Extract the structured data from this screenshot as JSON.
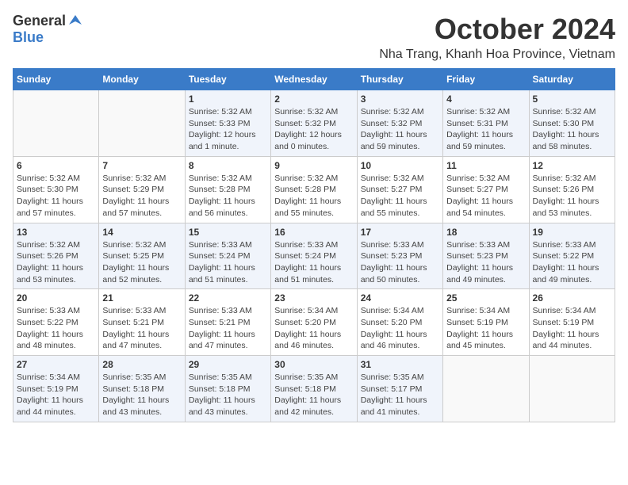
{
  "header": {
    "logo_general": "General",
    "logo_blue": "Blue",
    "month": "October 2024",
    "location": "Nha Trang, Khanh Hoa Province, Vietnam"
  },
  "days_of_week": [
    "Sunday",
    "Monday",
    "Tuesday",
    "Wednesday",
    "Thursday",
    "Friday",
    "Saturday"
  ],
  "weeks": [
    [
      {
        "day": "",
        "detail": ""
      },
      {
        "day": "",
        "detail": ""
      },
      {
        "day": "1",
        "detail": "Sunrise: 5:32 AM\nSunset: 5:33 PM\nDaylight: 12 hours\nand 1 minute."
      },
      {
        "day": "2",
        "detail": "Sunrise: 5:32 AM\nSunset: 5:32 PM\nDaylight: 12 hours\nand 0 minutes."
      },
      {
        "day": "3",
        "detail": "Sunrise: 5:32 AM\nSunset: 5:32 PM\nDaylight: 11 hours\nand 59 minutes."
      },
      {
        "day": "4",
        "detail": "Sunrise: 5:32 AM\nSunset: 5:31 PM\nDaylight: 11 hours\nand 59 minutes."
      },
      {
        "day": "5",
        "detail": "Sunrise: 5:32 AM\nSunset: 5:30 PM\nDaylight: 11 hours\nand 58 minutes."
      }
    ],
    [
      {
        "day": "6",
        "detail": "Sunrise: 5:32 AM\nSunset: 5:30 PM\nDaylight: 11 hours\nand 57 minutes."
      },
      {
        "day": "7",
        "detail": "Sunrise: 5:32 AM\nSunset: 5:29 PM\nDaylight: 11 hours\nand 57 minutes."
      },
      {
        "day": "8",
        "detail": "Sunrise: 5:32 AM\nSunset: 5:28 PM\nDaylight: 11 hours\nand 56 minutes."
      },
      {
        "day": "9",
        "detail": "Sunrise: 5:32 AM\nSunset: 5:28 PM\nDaylight: 11 hours\nand 55 minutes."
      },
      {
        "day": "10",
        "detail": "Sunrise: 5:32 AM\nSunset: 5:27 PM\nDaylight: 11 hours\nand 55 minutes."
      },
      {
        "day": "11",
        "detail": "Sunrise: 5:32 AM\nSunset: 5:27 PM\nDaylight: 11 hours\nand 54 minutes."
      },
      {
        "day": "12",
        "detail": "Sunrise: 5:32 AM\nSunset: 5:26 PM\nDaylight: 11 hours\nand 53 minutes."
      }
    ],
    [
      {
        "day": "13",
        "detail": "Sunrise: 5:32 AM\nSunset: 5:26 PM\nDaylight: 11 hours\nand 53 minutes."
      },
      {
        "day": "14",
        "detail": "Sunrise: 5:32 AM\nSunset: 5:25 PM\nDaylight: 11 hours\nand 52 minutes."
      },
      {
        "day": "15",
        "detail": "Sunrise: 5:33 AM\nSunset: 5:24 PM\nDaylight: 11 hours\nand 51 minutes."
      },
      {
        "day": "16",
        "detail": "Sunrise: 5:33 AM\nSunset: 5:24 PM\nDaylight: 11 hours\nand 51 minutes."
      },
      {
        "day": "17",
        "detail": "Sunrise: 5:33 AM\nSunset: 5:23 PM\nDaylight: 11 hours\nand 50 minutes."
      },
      {
        "day": "18",
        "detail": "Sunrise: 5:33 AM\nSunset: 5:23 PM\nDaylight: 11 hours\nand 49 minutes."
      },
      {
        "day": "19",
        "detail": "Sunrise: 5:33 AM\nSunset: 5:22 PM\nDaylight: 11 hours\nand 49 minutes."
      }
    ],
    [
      {
        "day": "20",
        "detail": "Sunrise: 5:33 AM\nSunset: 5:22 PM\nDaylight: 11 hours\nand 48 minutes."
      },
      {
        "day": "21",
        "detail": "Sunrise: 5:33 AM\nSunset: 5:21 PM\nDaylight: 11 hours\nand 47 minutes."
      },
      {
        "day": "22",
        "detail": "Sunrise: 5:33 AM\nSunset: 5:21 PM\nDaylight: 11 hours\nand 47 minutes."
      },
      {
        "day": "23",
        "detail": "Sunrise: 5:34 AM\nSunset: 5:20 PM\nDaylight: 11 hours\nand 46 minutes."
      },
      {
        "day": "24",
        "detail": "Sunrise: 5:34 AM\nSunset: 5:20 PM\nDaylight: 11 hours\nand 46 minutes."
      },
      {
        "day": "25",
        "detail": "Sunrise: 5:34 AM\nSunset: 5:19 PM\nDaylight: 11 hours\nand 45 minutes."
      },
      {
        "day": "26",
        "detail": "Sunrise: 5:34 AM\nSunset: 5:19 PM\nDaylight: 11 hours\nand 44 minutes."
      }
    ],
    [
      {
        "day": "27",
        "detail": "Sunrise: 5:34 AM\nSunset: 5:19 PM\nDaylight: 11 hours\nand 44 minutes."
      },
      {
        "day": "28",
        "detail": "Sunrise: 5:35 AM\nSunset: 5:18 PM\nDaylight: 11 hours\nand 43 minutes."
      },
      {
        "day": "29",
        "detail": "Sunrise: 5:35 AM\nSunset: 5:18 PM\nDaylight: 11 hours\nand 43 minutes."
      },
      {
        "day": "30",
        "detail": "Sunrise: 5:35 AM\nSunset: 5:18 PM\nDaylight: 11 hours\nand 42 minutes."
      },
      {
        "day": "31",
        "detail": "Sunrise: 5:35 AM\nSunset: 5:17 PM\nDaylight: 11 hours\nand 41 minutes."
      },
      {
        "day": "",
        "detail": ""
      },
      {
        "day": "",
        "detail": ""
      }
    ]
  ]
}
